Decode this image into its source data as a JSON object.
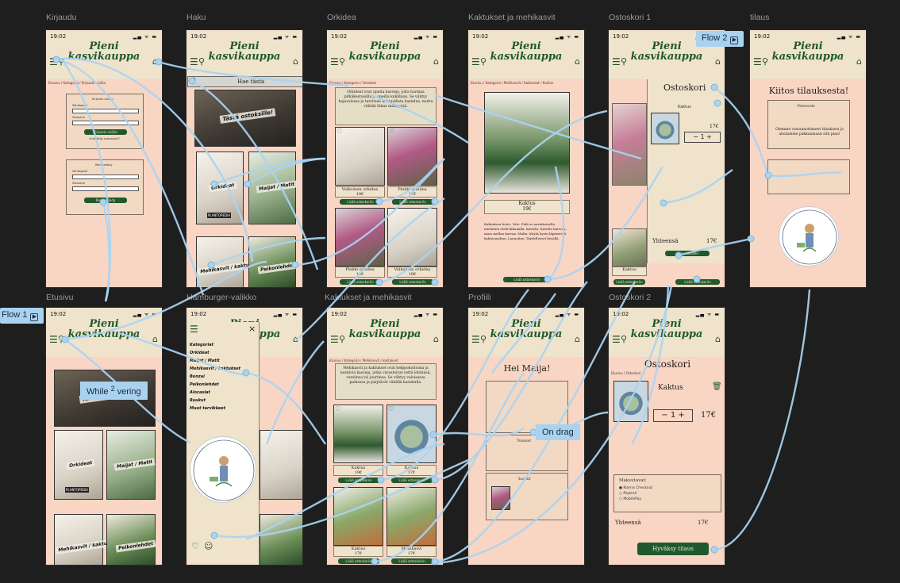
{
  "frames": {
    "kirjaudu": {
      "label": "Kirjaudu",
      "time": "19:02",
      "brand_line1": "Pieni",
      "brand_line2": "kasvikauppa",
      "breadcrumb": "Etusivu / Kategoria / Kirjaudu sisään",
      "login_title": "Kirjaudu sisään",
      "email_label": "Sähköposti",
      "password_label": "Salasana",
      "login_button": "Kirjaudu sisään",
      "forgot": "Unohditko salasanasi?",
      "register_title": "Rekisteröidy",
      "reg_email_label": "Sähköposti",
      "reg_password_label": "Salasana",
      "register_button": "Rekisteröidy"
    },
    "haku": {
      "label": "Haku",
      "time": "19:02",
      "search_placeholder": "Hae tästä",
      "hero": "Tästä ostoksille!",
      "cat1": "Orkideat",
      "cat2": "Maijat / Matit",
      "cat3": "Mehikasvit / kaktukset",
      "cat4": "Peikonlehdet",
      "book": "PLANTOPEDIA"
    },
    "orkidea": {
      "label": "Orkidea",
      "time": "19:02",
      "breadcrumb": "Etusivu / Kategoria / Orkideat",
      "intro": "Orkideat ovat upeita kasveja, joita hurmaa pitkäkestoisilla ja upeilla kukillaan. Se viihtyy hajavalossa ja tarvitsee kohtuullista kastelua, mutta välttää liikaa märkyyttä.",
      "products": [
        {
          "name": "Valkoinen orkidea",
          "price": "19€"
        },
        {
          "name": "Pinkki orkidea",
          "price": "17€"
        },
        {
          "name": "Pinkki orkidea",
          "price": "19€"
        },
        {
          "name": "Valkoinen orkidea",
          "price": "19€"
        }
      ],
      "add_button": "Lisää ostoskoriin"
    },
    "kaktukset1": {
      "label": "Kaktukset ja mehikasvit",
      "time": "19:02",
      "breadcrumb": "Etusivu / Kategoria / Mehikasvit / Kaktukset / Kaktus",
      "product_name": "Kaktus",
      "product_price": "19€",
      "desc": "Kaktuksen hoito: Valo: Pidä se aurinkoisella, mieluiten etelä-ikkunalla. Kastelu: Kastele harvoin, anna mullan kuivua. Multa: Käytä hyvin läpäisevää kaktusmultaa. Lannoitus: Täydellisesti kesällä.",
      "add_button": "Lisää ostoskoriin"
    },
    "ostoskori1": {
      "label": "Ostoskori 1",
      "time": "19:02",
      "cart_title": "Ostoskori",
      "item_name": "Kaktus",
      "item_price": "17€",
      "qty": "1",
      "total_label": "Yhteensä",
      "total_value": "17€",
      "checkout": "Siirry kassalle"
    },
    "tilaus": {
      "label": "tilaus",
      "time": "19:02",
      "thanks": "Kiitos tilauksesta!",
      "summary_title": "Yhteenveto",
      "message": "Olemme vastaanottaneet tilauksesi ja aloitamme pakkaamaan sitä pian!",
      "seal_text": "PIENI KASVIKAUPPA"
    },
    "etusivu": {
      "label": "Etusivu",
      "time": "19:02",
      "hero": "Tästä ostoksille!",
      "cat1": "Orkideat",
      "cat2": "Maijat / Matit",
      "cat3": "Mehikasvit / kaktukset",
      "cat4": "Peikonlehdet",
      "book": "PLANTOPEDIA"
    },
    "hamburger": {
      "label": "Hamburger-valikko",
      "time": "19:02",
      "items": [
        "Kategoriat",
        "Orkideat",
        "Maijat / Matit",
        "Mehikasvit / kaktukset",
        "Bonzai",
        "Peikonlehdet",
        "Alocasiat",
        "Ruukut",
        "Muut tarvikkeet"
      ],
      "seal_text": "PIENI KASVIKAUPPA"
    },
    "kaktukset2": {
      "label": "Kaktukset ja mehikasvit",
      "time": "19:02",
      "breadcrumb": "Etusivu / Kategoria / Mehikasvit / kaktukset",
      "intro": "Mehikasvit ja kaktukset ovat helppohoitoisia ja kestäviä kasveja, jotka varastoivat vettä lehtiinsä, varsiinsa tai juuriinsa. Se viihtyy valoisassa paikassa ja pärjäävät vähällä kastelulla.",
      "products": [
        {
          "name": "Kaktus",
          "price": "19€"
        },
        {
          "name": "Kaktus",
          "price": "17€"
        },
        {
          "name": "Kaktus",
          "price": "17€"
        },
        {
          "name": "Mehikasvi",
          "price": "17€"
        }
      ],
      "add_button": "Lisää ostoskoriin"
    },
    "profiili": {
      "label": "Profiili",
      "time": "19:02",
      "greeting": "Hei Maija!",
      "orders_label": "Tilaukset",
      "favorites_label": "Suosikit"
    },
    "ostoskori2": {
      "label": "Ostoskori 2",
      "time": "19:02",
      "title": "Ostoskori",
      "breadcrumb": "Etusivu / Ostoskori",
      "item_name": "Kaktus",
      "qty": "1",
      "item_price": "17€",
      "payment_title": "Maksutavat:",
      "payment_options": [
        "Klarna Checkout",
        "Paytrail",
        "MobilePay"
      ],
      "total_label": "Yhteensä",
      "total_value": "17€",
      "accept_button": "Hyväksy tilaus"
    }
  },
  "flows": {
    "flow1_label": "Flow 1",
    "flow2_label": "Flow 2",
    "hint_hover_a": "While",
    "hint_hover_b": "2",
    "hint_hover_c": "vering",
    "hint_drag": "On drag"
  },
  "colors": {
    "canvas": "#1e1e1e",
    "frame_bg": "#f9d5c4",
    "header_bg": "#efe3cc",
    "brand_green": "#1f5a2e",
    "wire": "#a9d4f2"
  }
}
